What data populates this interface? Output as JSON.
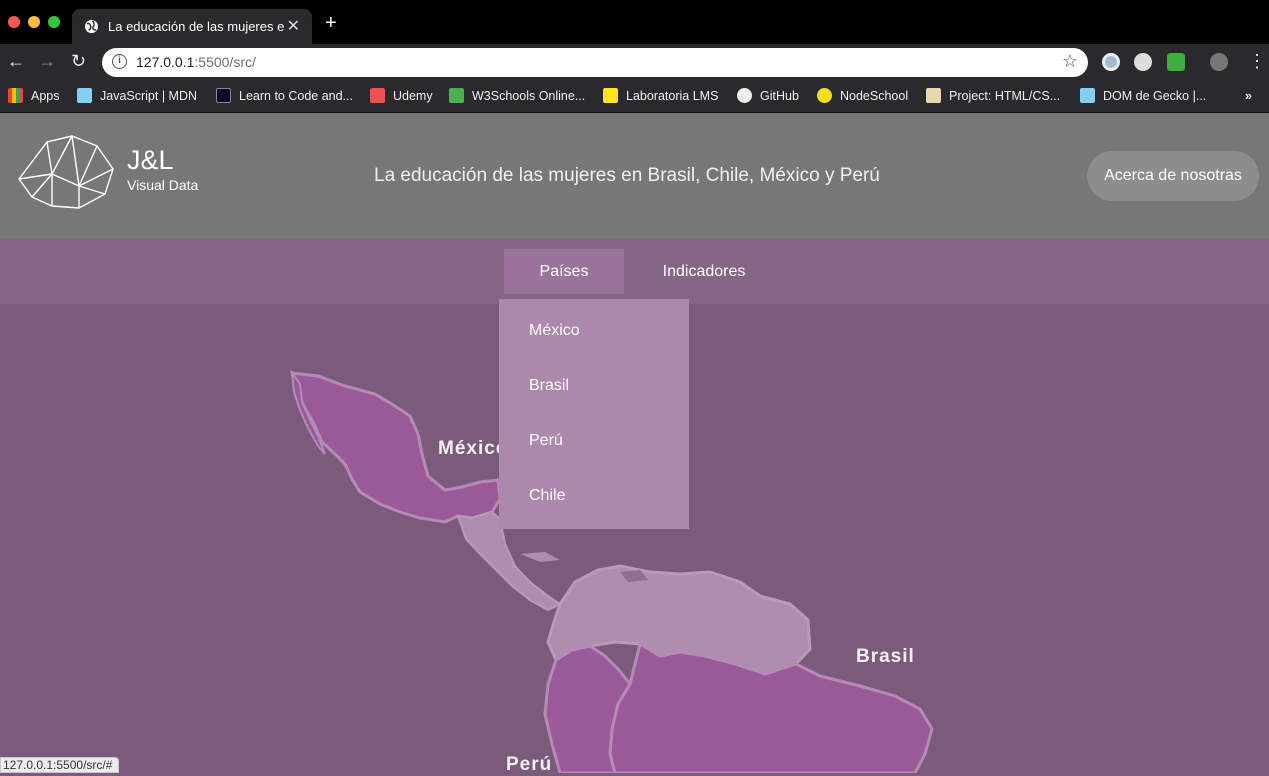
{
  "browser": {
    "tab_title": "La educación de las mujeres en Brasil, Chile, México y Perú",
    "url_host": "127.0.0.1",
    "url_rest": ":5500/src/",
    "status_url": "127.0.0.1:5500/src/#",
    "bookmarks": [
      {
        "label": "Apps",
        "icon": "apps-grid-icon",
        "color": "#e0483b"
      },
      {
        "label": "JavaScript | MDN",
        "icon": "mdn-icon",
        "color": "#83d0f2"
      },
      {
        "label": "Learn to Code and...",
        "icon": "freecodecamp-icon",
        "color": "#0a0a23"
      },
      {
        "label": "Udemy",
        "icon": "udemy-icon",
        "color": "#ec5252"
      },
      {
        "label": "W3Schools Online...",
        "icon": "w3schools-icon",
        "color": "#4caf50"
      },
      {
        "label": "Laboratoria LMS",
        "icon": "laboratoria-icon",
        "color": "#ffe521"
      },
      {
        "label": "GitHub",
        "icon": "github-icon",
        "color": "#111111"
      },
      {
        "label": "NodeSchool",
        "icon": "nodeschool-icon",
        "color": "#f7df1e"
      },
      {
        "label": "Project: HTML/CS...",
        "icon": "project-icon",
        "color": "#e8d8b0"
      },
      {
        "label": "DOM de Gecko |...",
        "icon": "mdn-icon",
        "color": "#83d0f2"
      }
    ]
  },
  "site": {
    "brand": "J&L",
    "brand_sub": "Visual Data",
    "title": "La educación de las mujeres en Brasil, Chile, México y Perú",
    "about": "Acerca de nosotras",
    "nav": {
      "countries": "Países",
      "indicators": "Indicadores"
    },
    "dropdown": [
      "México",
      "Brasil",
      "Perú",
      "Chile"
    ],
    "map_labels": {
      "mexico": "México",
      "brasil": "Brasil",
      "peru": "Perú"
    }
  },
  "colors": {
    "header_bg": "#787778",
    "nav_bg": "#856584",
    "page_bg": "#7b5b7b",
    "dropdown_bg": "#ad88ad",
    "highlight_country": "#9a5a9a",
    "other_land": "#ad8fad"
  }
}
